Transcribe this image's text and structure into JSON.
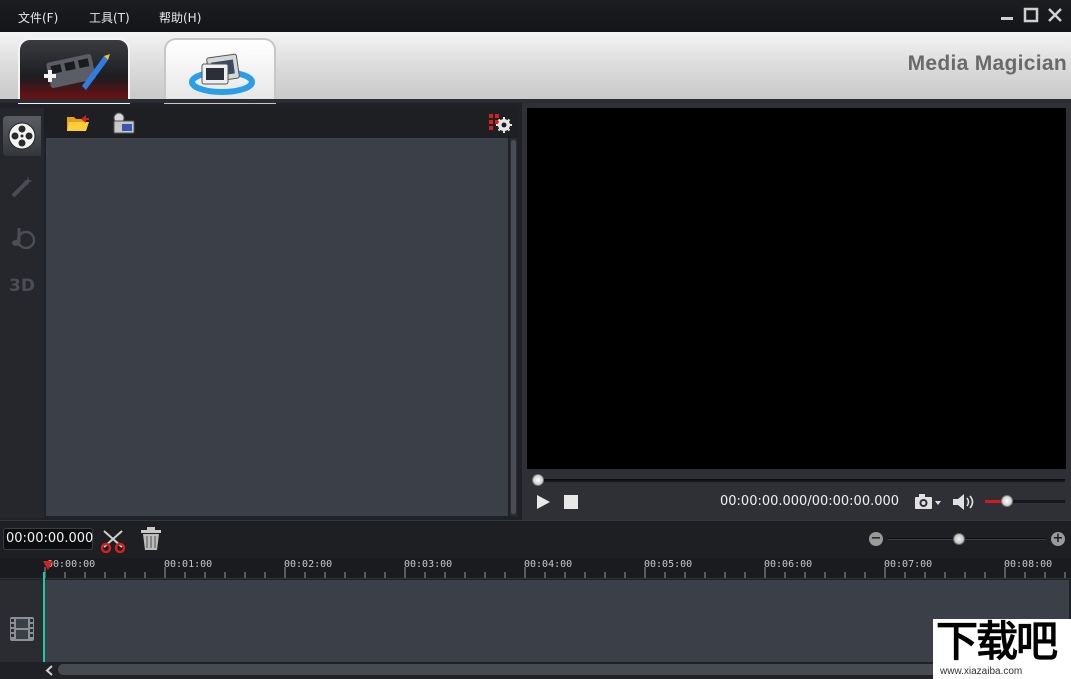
{
  "menu": {
    "items": [
      {
        "label": "文件(F)"
      },
      {
        "label": "工具(T)"
      },
      {
        "label": "帮助(H)"
      }
    ],
    "window_controls": {
      "minimize_icon": "minimize-icon",
      "maximize_icon": "maximize-icon",
      "close_icon": "close-icon"
    }
  },
  "header": {
    "app_title": "Media Magician",
    "tabs": [
      {
        "id": "edit",
        "icon": "film-edit-icon",
        "active": true
      },
      {
        "id": "convert",
        "icon": "video-convert-icon",
        "active": false
      }
    ]
  },
  "sidebar": {
    "items": [
      {
        "icon": "film-reel-icon",
        "active": true
      },
      {
        "icon": "magic-wand-icon",
        "active": false
      },
      {
        "icon": "music-note-icon",
        "active": false
      },
      {
        "icon": "3d-icon",
        "label": "3D",
        "active": false
      }
    ]
  },
  "library": {
    "toolbar": {
      "open_folder_icon": "open-folder-icon",
      "capture_icon": "camera-import-icon",
      "settings_icon": "grid-settings-icon"
    }
  },
  "preview": {
    "progress": 0,
    "time": "00:00:00.000/00:00:00.000",
    "volume": 0.27,
    "colors": {
      "screen": "#000000",
      "volume_fill": "#d11a1a"
    }
  },
  "timeline": {
    "current_time": "00:00:00.000",
    "zoom_level": 0.45,
    "ruler_labels": [
      "00:00:00",
      "00:01:00",
      "00:02:00",
      "00:03:00",
      "00:04:00",
      "00:05:00",
      "00:06:00",
      "00:07:00",
      "00:08:00"
    ],
    "colors": {
      "playhead": "#d32020",
      "cursor_line": "#1ec8a0"
    }
  },
  "watermark": {
    "main": "下载吧",
    "sub": "www.xiazaiba.com"
  }
}
